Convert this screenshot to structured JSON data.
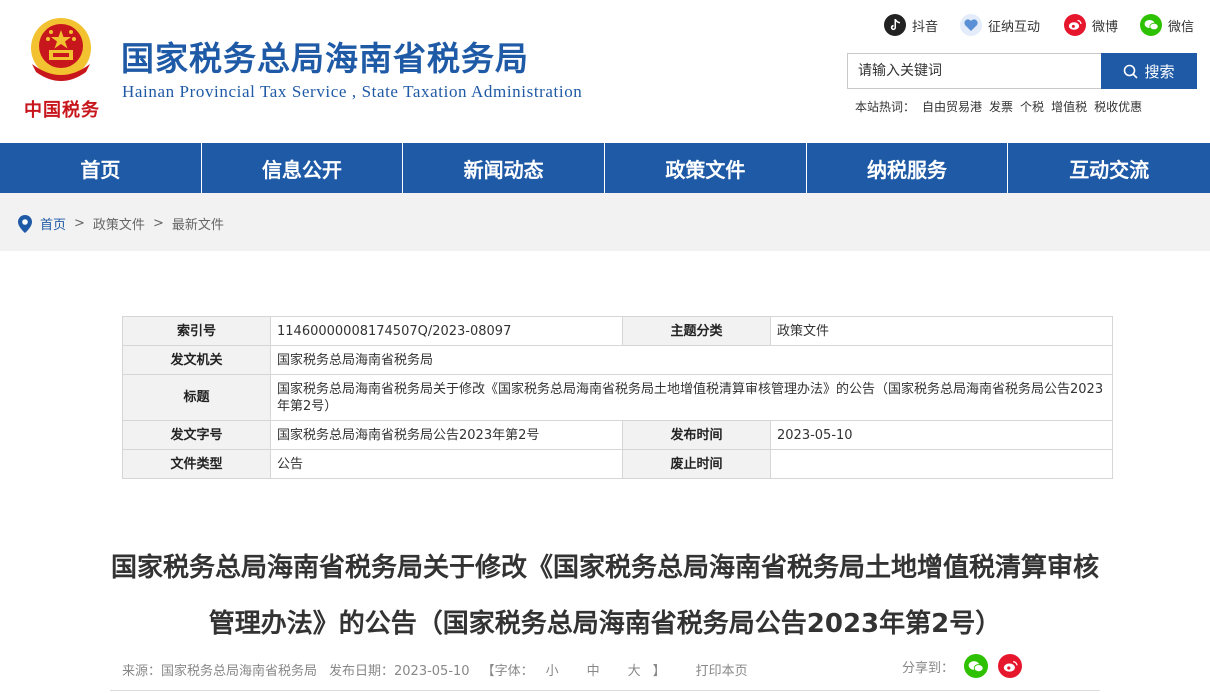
{
  "header": {
    "brand_script": "中国税务",
    "title": "国家税务总局海南省税务局",
    "subtitle": "Hainan  Provincial  Tax  Service , State  Taxation  Administration"
  },
  "social": [
    {
      "label": "抖音",
      "icon": "douyin-icon",
      "color": "#222222"
    },
    {
      "label": "征纳互动",
      "icon": "interaction-icon",
      "color": "#5b8fd6"
    },
    {
      "label": "微博",
      "icon": "weibo-icon",
      "color": "#e6162d"
    },
    {
      "label": "微信",
      "icon": "wechat-icon",
      "color": "#2dc100"
    }
  ],
  "search": {
    "placeholder": "请输入关键词",
    "button_label": "搜索",
    "hot_label": "本站热词：",
    "hotwords": [
      "自由贸易港",
      "发票",
      "个税",
      "增值税",
      "税收优惠"
    ]
  },
  "nav": [
    "首页",
    "信息公开",
    "新闻动态",
    "政策文件",
    "纳税服务",
    "互动交流"
  ],
  "breadcrumb": {
    "items": [
      "首页",
      "政策文件",
      "最新文件"
    ],
    "separator": ">"
  },
  "meta": {
    "index_label": "索引号",
    "index_value": "11460000008174507Q/2023-08097",
    "topic_label": "主题分类",
    "topic_value": "政策文件",
    "issuer_label": "发文机关",
    "issuer_value": "国家税务总局海南省税务局",
    "title_label": "标题",
    "title_value": "国家税务总局海南省税务局关于修改《国家税务总局海南省税务局土地增值税清算审核管理办法》的公告（国家税务总局海南省税务局公告2023年第2号）",
    "docno_label": "发文字号",
    "docno_value": "国家税务总局海南省税务局公告2023年第2号",
    "pubdate_label": "发布时间",
    "pubdate_value": "2023-05-10",
    "doctype_label": "文件类型",
    "doctype_value": "公告",
    "repeal_label": "废止时间",
    "repeal_value": ""
  },
  "article": {
    "title": "国家税务总局海南省税务局关于修改《国家税务总局海南省税务局土地增值税清算审核管理办法》的公告（国家税务总局海南省税务局公告2023年第2号）"
  },
  "info": {
    "source": "来源：国家税务总局海南省税务局",
    "date": "发布日期：2023-05-10",
    "font_open": "【字体：",
    "font_small": "小",
    "font_medium": "中",
    "font_large": "大",
    "font_close": "】",
    "print": "打印本页",
    "share_label": "分享到："
  },
  "colors": {
    "brand_blue": "#1f5aa6",
    "emblem_red": "#c8161d",
    "emblem_gold": "#f2c230"
  }
}
